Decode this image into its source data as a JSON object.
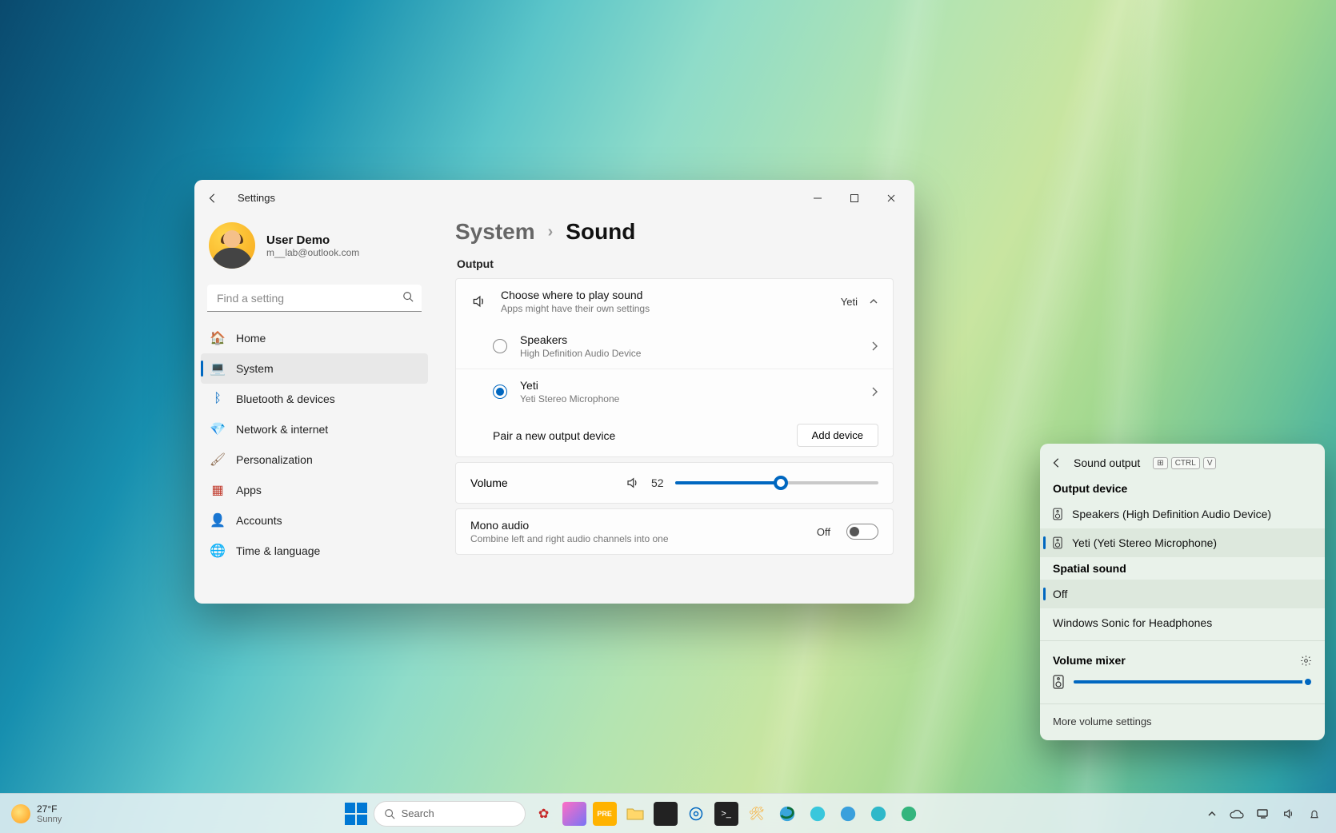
{
  "settings": {
    "app_title": "Settings",
    "profile": {
      "name": "User Demo",
      "email": "m__lab@outlook.com"
    },
    "search_placeholder": "Find a setting",
    "nav": [
      {
        "label": "Home"
      },
      {
        "label": "System"
      },
      {
        "label": "Bluetooth & devices"
      },
      {
        "label": "Network & internet"
      },
      {
        "label": "Personalization"
      },
      {
        "label": "Apps"
      },
      {
        "label": "Accounts"
      },
      {
        "label": "Time & language"
      }
    ],
    "nav_selected_index": 1,
    "breadcrumb": {
      "root": "System",
      "leaf": "Sound"
    },
    "output": {
      "section": "Output",
      "choose_title": "Choose where to play sound",
      "choose_sub": "Apps might have their own settings",
      "selected_device": "Yeti",
      "devices": [
        {
          "name": "Speakers",
          "sub": "High Definition Audio Device",
          "checked": false
        },
        {
          "name": "Yeti",
          "sub": "Yeti Stereo Microphone",
          "checked": true
        }
      ],
      "pair_label": "Pair a new output device",
      "add_btn": "Add device"
    },
    "volume": {
      "label": "Volume",
      "value": 52
    },
    "mono": {
      "title": "Mono audio",
      "sub": "Combine left and right audio channels into one",
      "state": "Off"
    }
  },
  "flyout": {
    "title": "Sound output",
    "shortcut_keys": [
      "CTRL",
      "V"
    ],
    "section_device": "Output device",
    "devices": [
      {
        "label": "Speakers (High Definition Audio Device)",
        "selected": false
      },
      {
        "label": "Yeti (Yeti Stereo Microphone)",
        "selected": true
      }
    ],
    "section_spatial": "Spatial sound",
    "spatial": [
      {
        "label": "Off",
        "selected": true
      },
      {
        "label": "Windows Sonic for Headphones",
        "selected": false
      }
    ],
    "mixer_title": "Volume mixer",
    "mixer_value": 100,
    "more": "More volume settings"
  },
  "taskbar": {
    "weather": {
      "temp": "27°F",
      "desc": "Sunny"
    },
    "search_placeholder": "Search"
  }
}
